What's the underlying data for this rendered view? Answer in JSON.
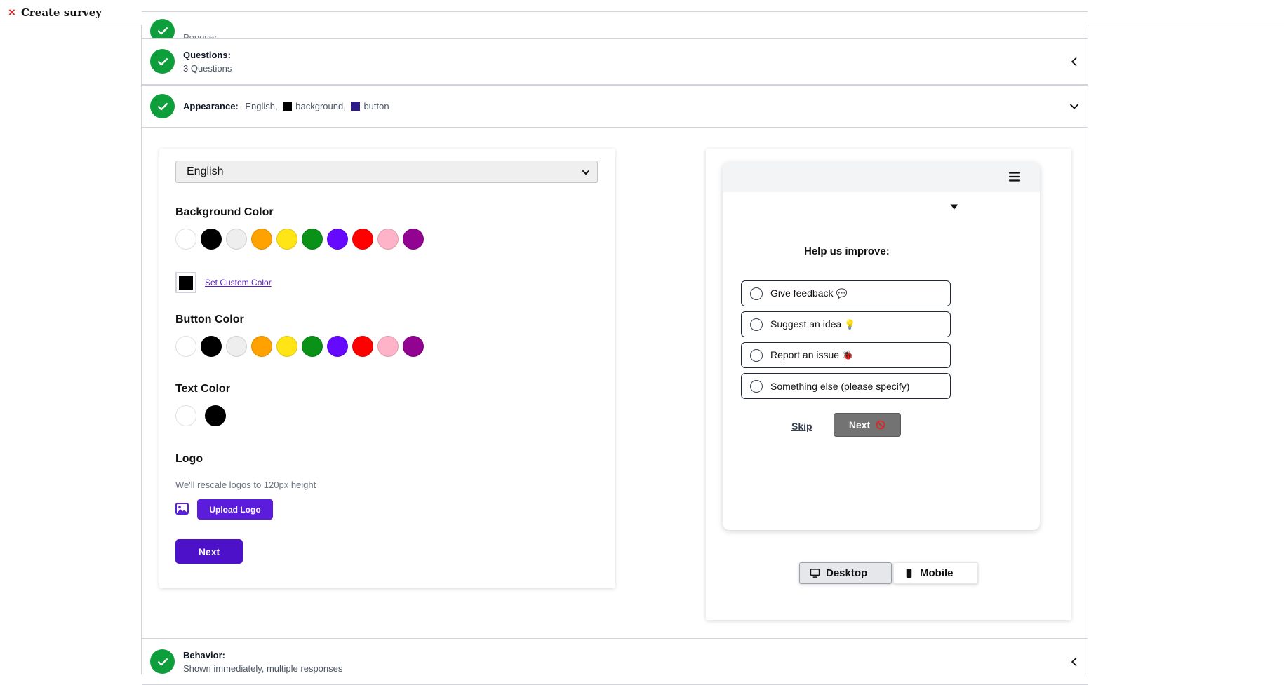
{
  "topbar": {
    "close_icon": "×",
    "title": "Create survey"
  },
  "sections": {
    "popover": {
      "label": "",
      "value": "Popover"
    },
    "questions": {
      "label": "Questions:",
      "value": "3 Questions"
    },
    "appearance": {
      "label": "Appearance:",
      "language": "English,",
      "background_label": "background,",
      "background_color": "#000000",
      "button_label": "button",
      "button_color": "#2e1a86"
    },
    "behavior": {
      "label": "Behavior:",
      "value": "Shown immediately, multiple responses"
    }
  },
  "settings": {
    "language_value": "English",
    "background_heading": "Background Color",
    "background_palette": [
      "#ffffff",
      "#000000",
      "#eeeeee",
      "#ffa200",
      "#ffe516",
      "#0a9117",
      "#6509ff",
      "#ff0000",
      "#ffb3c8",
      "#920391"
    ],
    "custom_color_link": "Set Custom Color",
    "custom_color_value": "#000000",
    "button_heading": "Button Color",
    "button_palette": [
      "#ffffff",
      "#000000",
      "#eeeeee",
      "#ffa200",
      "#ffe516",
      "#0a9117",
      "#6509ff",
      "#ff0000",
      "#ffb3c8",
      "#920391"
    ],
    "text_heading": "Text Color",
    "text_palette": [
      "#ffffff",
      "#000000"
    ],
    "logo_heading": "Logo",
    "logo_note": "We'll rescale logos to 120px height",
    "upload_button": "Upload Logo",
    "next_button": "Next"
  },
  "preview": {
    "question": "Help us improve:",
    "options": [
      {
        "text": "Give feedback",
        "emoji": "💬"
      },
      {
        "text": "Suggest an idea",
        "emoji": "💡"
      },
      {
        "text": "Report an issue",
        "emoji": "🐞"
      },
      {
        "text": "Something else (please specify)",
        "emoji": ""
      }
    ],
    "skip": "Skip",
    "next": "Next",
    "device_desktop": "Desktop",
    "device_mobile": "Mobile"
  },
  "colors": {
    "check_green": "#0e9f3c",
    "accent_purple": "#5b1cdb",
    "close_red": "#dc2626"
  }
}
